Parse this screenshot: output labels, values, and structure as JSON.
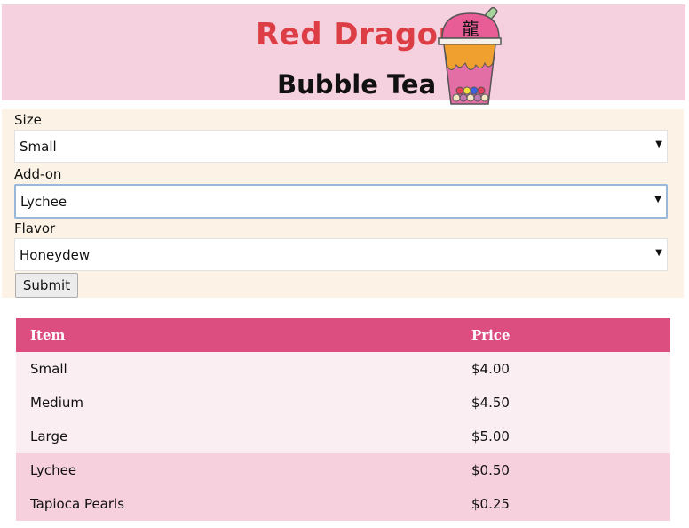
{
  "header": {
    "title_line1": "Red Dragon",
    "title_line2": "Bubble Tea",
    "logo_character": "龍"
  },
  "form": {
    "size": {
      "label": "Size",
      "value": "Small"
    },
    "addon": {
      "label": "Add-on",
      "value": "Lychee"
    },
    "flavor": {
      "label": "Flavor",
      "value": "Honeydew"
    },
    "submit_label": "Submit"
  },
  "price_table": {
    "headers": [
      "Item",
      "Price"
    ],
    "rows": [
      {
        "item": "Small",
        "price": "$4.00",
        "group": "size"
      },
      {
        "item": "Medium",
        "price": "$4.50",
        "group": "size"
      },
      {
        "item": "Large",
        "price": "$5.00",
        "group": "size"
      },
      {
        "item": "Lychee",
        "price": "$0.50",
        "group": "addon"
      },
      {
        "item": "Tapioca Pearls",
        "price": "$0.25",
        "group": "addon"
      }
    ]
  },
  "colors": {
    "header_bg": "#f5d0de",
    "brand_red": "#dd3e45",
    "form_bg": "#fcf3e6",
    "table_header": "#dc4d80",
    "size_row_bg": "#fbeef2",
    "addon_row_bg": "#f6d0dd"
  }
}
